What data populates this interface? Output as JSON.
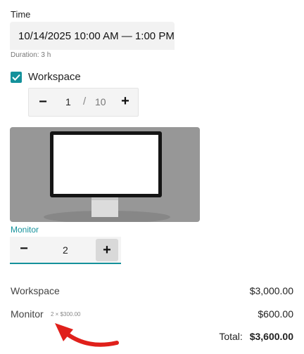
{
  "time": {
    "label": "Time",
    "value": "10/14/2025 10:00 AM — 1:00 PM",
    "duration": "Duration: 3 h"
  },
  "workspace": {
    "checked": true,
    "label": "Workspace",
    "quantity": "1",
    "separator": "/",
    "max": "10",
    "minus_icon": "−",
    "plus_icon": "+"
  },
  "monitor": {
    "label": "Monitor",
    "quantity": "2",
    "minus_icon": "−",
    "plus_icon": "+"
  },
  "summary": {
    "workspace_label": "Workspace",
    "workspace_amount": "$3,000.00",
    "monitor_label": "Monitor",
    "monitor_unit_note": "2 × $300.00",
    "monitor_amount": "$600.00",
    "total_label": "Total:",
    "total_amount": "$3,600.00"
  },
  "colors": {
    "accent": "#14919b",
    "arrow": "#e0201b"
  }
}
